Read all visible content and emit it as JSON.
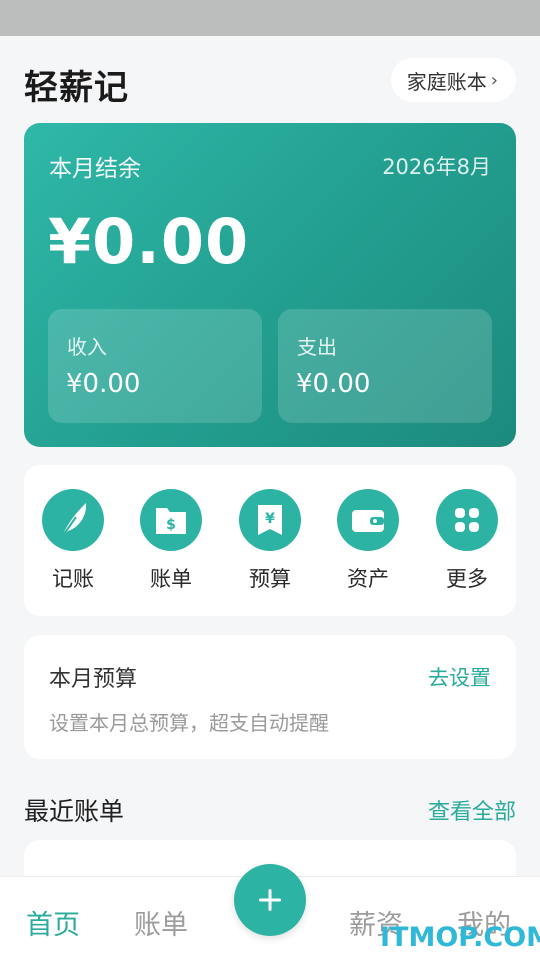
{
  "header": {
    "app_title": "轻薪记",
    "family_button_label": "家庭账本",
    "family_button_icon": "chevron-right-icon"
  },
  "balance_card": {
    "label": "本月结余",
    "month": "2026年8月",
    "amount": "¥0.00",
    "income": {
      "label": "收入",
      "value": "¥0.00"
    },
    "expense": {
      "label": "支出",
      "value": "¥0.00"
    },
    "gradient_colors": [
      "#2fb8a8",
      "#1c8a7d"
    ]
  },
  "shortcuts": [
    {
      "label": "记账",
      "icon": "feather-icon"
    },
    {
      "label": "账单",
      "icon": "bill-folder-icon"
    },
    {
      "label": "预算",
      "icon": "budget-icon"
    },
    {
      "label": "资产",
      "icon": "wallet-icon"
    },
    {
      "label": "更多",
      "icon": "grid-icon"
    }
  ],
  "budget": {
    "title": "本月预算",
    "link": "去设置",
    "description": "设置本月总预算，超支自动提醒"
  },
  "recent": {
    "title": "最近账单",
    "link": "查看全部"
  },
  "tab_bar": {
    "tabs": [
      "首页",
      "账单",
      "薪资",
      "我的"
    ],
    "active": "首页",
    "add_icon": "plus-icon"
  },
  "watermark": "ITMOP.COM",
  "colors": {
    "accent": "#2aab9b",
    "background": "#f5f6f8"
  }
}
